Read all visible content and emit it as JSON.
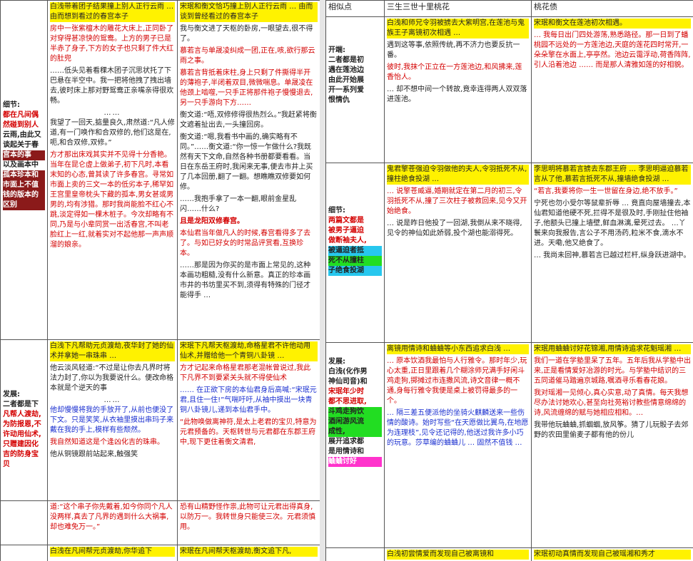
{
  "left": {
    "rows": [
      {
        "category": {
          "lines": [
            "细节:",
            "都在凡间偶",
            "然碰到别人",
            "云雨,由此又",
            "谈起关于春",
            "宫本的事",
            "以及画本中",
            "孤本珍本和",
            "市面上不值",
            "钱的版本的",
            "区别"
          ]
        },
        "col1": {
          "head": "白浅带着团子结果撞上别人正行云雨 … 由而想到看过的春宫本子",
          "paras": [
            "房中一张紫檀木的雕花大床上,正同卧了对穿得甚凉快的鸳鸯。上方的男子已是半赤了身子,下方的女子也只剩了件大红的肚兜",
            "……低头见着看稞木团子沉思状托了下巴悬在半空中。我一把将他拽了拽出墙去,彼时床上那对野鸳鸯正亲嘴亲得很欢畅。",
            "……",
            "我望了一回天,掂量良久,肃然道:“凡人修道,有一门唤作和合双修的,他们这是在,呃,和合双修,双修。”",
            "方才那出床戏其实并不见得十分香艳。当年在昆仑虚上做弟子,初下凡时,本看末知的心态,曾其读了许多春宫。寻常如市面上卖的三文一本的低劣本子,稀罕如王宫里皇帝枕头下藏的孤本,男女甚或男男的,均有涉猎。那时我尚能脸不红心不跳,淡定得如一棵木桩子。今次却略有不同,乃是与小辈同赏一出活春宫,不叫老脸红上一红,就着实对不起他那一声声顺溜的娘亲。"
          ]
        },
        "col2": {
          "head": "宋珉和衡文恰巧撞上别人正行云雨 … 由而谈到曾经看过的春宫本子",
          "paras": [
            "我与衡文进了天枢的卧房,一眼望去,很不得了。",
            "慕若言与单晟凌纠成一团,正在,咳,欲行那云雨之事。",
            "慕若言背抵着床柱,身上只剩了件撕得半开的薄袍子,半闭着双目,微微喘息。单晟凌在他颈上啮噬,一只手正将那件袍子慢慢退去,另一只手游向下方……",
            "衡文道:“唔,双修修得很热烈么。”我赶紧将衡文遮着扯出去,一头撞回房。",
            "衡文道:“嗯,我看书中画的,确实略有不同。”……衡文道:“你一惊一乍做什么?我既然有天下文命,自然各种书册都要看看。当日在东岳王府时,我闲来无事,便去市井上买了几本回册,翻了一翻。想瞧瞧双修要如何修。",
            "……我抱手拿了一本一翻,眼前金星乱闪……什么?",
            "且是龙阳双修春宫。",
            "本仙君当年做凡人的时候,春宫看得多了去了。与如已好女的时常品评赏看,互换珍本。",
            "……那是因为你买的是市面上常见的,这种本画功粗糙,没有什么新意。真正的珍本画市井的书坊里买不到,须得有特殊的门径才能得手 …"
          ]
        }
      },
      {
        "category": {
          "lines": [
            "发展:",
            "二者都是下",
            "凡帮人渡劫,",
            "为防报恩,不",
            "许动用仙术,",
            "只赠建因化",
            "吉的防身宝",
            "贝"
          ]
        },
        "col1": {
          "head": "白浅下凡帮助元贞渡劫,夜华封了她的仙术并拿她一串珠串 …",
          "paras": [
            "他云淡风轻道:“不过是让你去凡界时将法力封了,你以为我要说什么。便改命格本就是个逆天的事",
            "……",
            "他却慢慢将我的手放开了,从前也便没了下文。只是笑笑,从衣袖里摸出串玛子来戴在我的手上,模样有些颓然。",
            "我自然知道这是个逢凶化吉的珠串。",
            "他从铜镜跟前站起来,触强笑"
          ]
        },
        "col2": {
          "head": "宋珉下凡帮天枢渡劫,命格星君不许他动用仙术,并赠给他一个青铜八卦镜 …",
          "paras": [
            "方才记起来命格星君那老混帐曾说过,我此下凡界不到要紧关头就不得使仙术",
            "…… 在正欲下房的本仙君身后高喊:“宋珉元君,且住一住!”气喘吁吁,从袖中摸出一块青铜八卦镜儿,递到本仙君手中。",
            "“此物唤做离神符,是太上老君的宝贝,特意为元君预备的。天枢转世与元君都在东郡王府中,现下更住着衡文清君,"
          ]
        }
      },
      {
        "category": {
          "lines": []
        },
        "col1": {
          "head": "",
          "paras": [
            "道:“这个串子你先戴着,如今你同个凡人没两样,真去了凡界的遇到什么大祸事,却也难免万一。”"
          ]
        },
        "col2": {
          "head": "",
          "paras": [
            "恐有山精野怪作祟,此物可让元君出得真身,以防万一。我转世身只能使三次。元君须慎用。"
          ]
        }
      },
      {
        "category": {
          "lines": []
        },
        "col1": {
          "head": "白浅在凡间帮元贞渡劫,你华追下",
          "paras": []
        },
        "col2": {
          "head": "宋珉在凡间帮天枢渡劫,衡文追下凡,",
          "paras": []
        }
      }
    ]
  },
  "right": {
    "headers": [
      "相似点",
      "三生三世十里桃花",
      "桃花债"
    ],
    "rows": [
      {
        "category": {
          "lines": [
            "开端:",
            "二者都是初",
            "遇在莲池边",
            "由此开始展",
            "开一系列爱",
            "恨情仇"
          ]
        },
        "col1": {
          "head": "白浅和师兄令羽被掳去大紫明宫,在莲池与鬼族王子离镜初次相遇 …",
          "paras": [
            "遇到这等事,依照传统,再不济力也要反抗一番。",
            "彼时,我抹个正立在一方莲池边,和风拂来,莲香怡人。",
            "… 却不想中间一个转故,竟幸连得两人双双落进莲池。"
          ]
        },
        "col2": {
          "head": "宋珉和衡文在莲池初次相遇。",
          "paras": [
            "… 我每日出门四处游荡,熟悉路径。那一日到了蟠桃园不远处的一方莲池边,天庭的莲花四时常开,一朵朵擎在水面上,亭亭然。池边云霭浮动,荷香阵阵,引人沿着池边 …… 而是那人清雅如莲的好相貌。"
          ]
        }
      },
      {
        "category": {
          "lines": [
            "细节:",
            "两篇文都是",
            "被男子逼迫",
            "做断袖夫人,",
            "被逼迫者抵",
            "死不从撞柱",
            "子绝食投湖"
          ]
        },
        "col1": {
          "head": "鬼君擎苍强迫令羽做他的夫人,令羽抵死不从,撞柱绝食投湖 …",
          "paras": [
            "… 说擎苍威逼,婚期就定在第二月的初三,令羽抵死不从,撞了三次柱子被救回来,见今又开始绝食。",
            "… 说是昨日他投了一回湖,我倒从来不晓得,见令的神仙如此娇弱,投个湖也能溺得死。"
          ]
        },
        "col2": {
          "head": "李思明将慕若言掳去东郡王府 … 李思明逼迫慕若言从了他,慕若言抵死不从,撞墙绝食投湖 …",
          "paras": [
            "“若言,我要将你一生一世留在身边,绝不放手。”",
            "宁死也勿小受尔等鼠辈折辱 … 竟直向屋墙撞去,本仙君知道他硬不死,拦得不是很及时,手刚扯住他袖子,他额头已撞上墙壁,鲜血淋漓,晕死过去。 …丫鬟来向我报告,言公子不用汤药,粒米不食,滴水不进。天嘞,他又绝食了。",
            "… 我尚未回神,慕若言已越过栏杆,纵身跃进湖中。"
          ]
        }
      },
      {
        "category": {
          "lines": [
            "发展:",
            "白浅(化作男",
            "神仙司音)和",
            "宋珉年少时",
            "都不思进取,",
            "斗鸡走狗饮",
            "酒闲游风流",
            "成性,",
            "展开追求都",
            "是用情诗和",
            "蛐蛐讨好"
          ]
        },
        "col1": {
          "head": "离镜用情诗和蛐蛐等小东西追求白浅 …",
          "paras": [
            "… 原本饮酒我最怕与人行雅令。那时年少,玩心太重,正日里跟着几个糊涂师兄满手好闲斗鸡走狗,掷摊过市连撒风流,诗文音律一概不通,身每行雅令我便是桌上被罚得最多的一个。",
            "… 隔三差五便派他的坐骑火麒麟送来一些伤情的酸诗。始时写些“在天愿做比翼鸟,在地愿为连理枝”,见令还记得的,他送过我许多小巧的玩意。莎草编的蛐蛐儿 … 固然不值钱 …"
          ]
        },
        "col2": {
          "head": "宋珉用蛐蛐讨好花锦湘,用情诗追求花魁瑶湘 …",
          "paras": [
            "我们一道在学塾里呆了五年。五年后我从学塾中出来,正是看情爱好冶游的时光。与学塾中结识的三五同道催马踏遍京城路,嘱酒寻乐看春花娘。",
            "我对瑶湘一见倾心,真心实意,动了真情。每天我想尽办法讨她欢心,甚至向社苑裕讨教些情意绵绵的诗,风流缠绵的赋与她相应相和。…",
            "我带他玩蛐蛐,抓蝈蝈,放风筝。猜了儿玩骰子去郊野的农田里偷麦子都有他的份儿"
          ]
        }
      },
      {
        "category": {
          "lines": []
        },
        "col1": {
          "head": "白浅初尝情爱而发现自己被离镜和",
          "paras": []
        },
        "col2": {
          "head": "宋珉初动真情而发现自己被瑶湘和秀才",
          "paras": []
        }
      }
    ]
  },
  "colors": {
    "yellow": "#fff200",
    "green": "#22dd22",
    "cyan": "#27c7ee",
    "magenta": "#ff33cc",
    "darkred": "#8b1a1a",
    "blue": "#1f3fae",
    "red_text": "#d40000"
  }
}
